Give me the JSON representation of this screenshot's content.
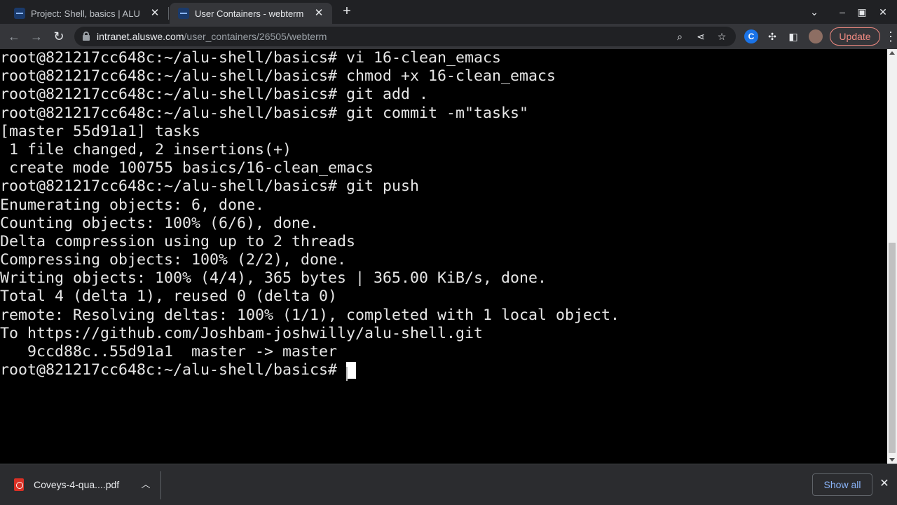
{
  "browser": {
    "tabs": [
      {
        "title": "Project: Shell, basics | ALU",
        "active": false
      },
      {
        "title": "User Containers - webterm",
        "active": true
      }
    ],
    "new_tab_icon": "plus-icon",
    "window_controls": [
      "chevron-down-icon",
      "minimize-icon",
      "maximize-icon",
      "close-icon"
    ],
    "toolbar": {
      "url_host": "intranet.aluswe.com",
      "url_path": "/user_containers/26505/webterm",
      "update_label": "Update"
    }
  },
  "terminal": {
    "lines": [
      "root@821217cc648c:~/alu-shell/basics# vi 16-clean_emacs",
      "root@821217cc648c:~/alu-shell/basics# chmod +x 16-clean_emacs",
      "root@821217cc648c:~/alu-shell/basics# git add .",
      "root@821217cc648c:~/alu-shell/basics# git commit -m\"tasks\"",
      "[master 55d91a1] tasks",
      " 1 file changed, 2 insertions(+)",
      " create mode 100755 basics/16-clean_emacs",
      "root@821217cc648c:~/alu-shell/basics# git push",
      "Enumerating objects: 6, done.",
      "Counting objects: 100% (6/6), done.",
      "Delta compression using up to 2 threads",
      "Compressing objects: 100% (2/2), done.",
      "Writing objects: 100% (4/4), 365 bytes | 365.00 KiB/s, done.",
      "Total 4 (delta 1), reused 0 (delta 0)",
      "remote: Resolving deltas: 100% (1/1), completed with 1 local object.",
      "To https://github.com/Joshbam-joshwilly/alu-shell.git",
      "   9ccd88c..55d91a1  master -> master"
    ],
    "prompt": "root@821217cc648c:~/alu-shell/basics# "
  },
  "downloads": {
    "file_name": "Coveys-4-qua....pdf",
    "show_all_label": "Show all"
  }
}
